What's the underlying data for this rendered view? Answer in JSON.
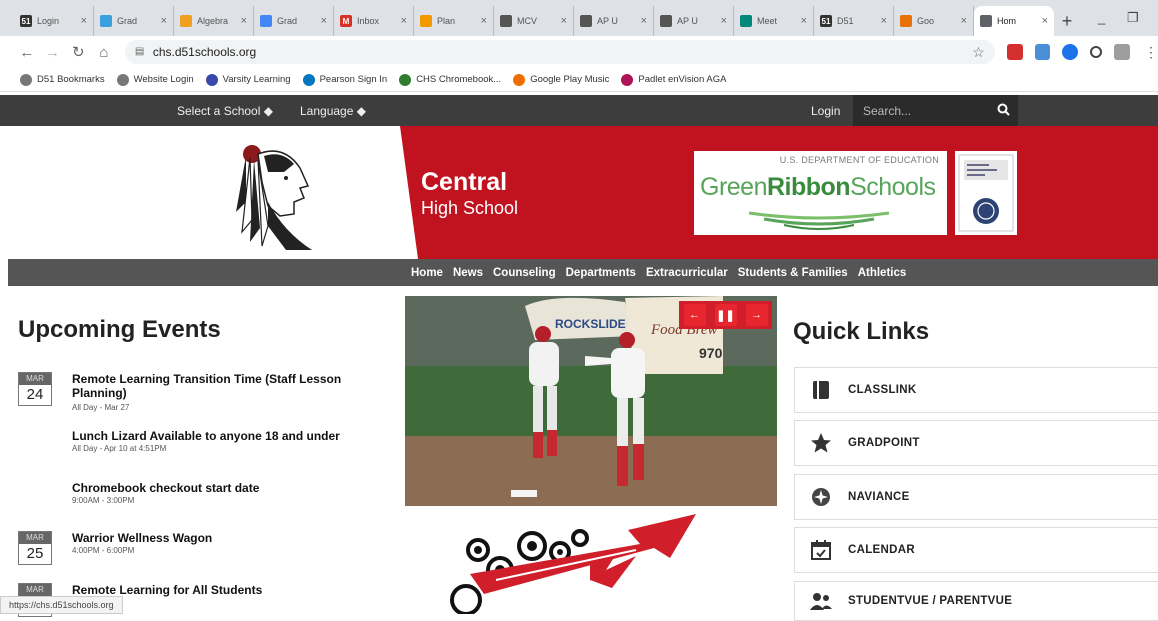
{
  "browser": {
    "tabs": [
      {
        "label": "Login",
        "favicon": "51",
        "color": "#333"
      },
      {
        "label": "Grad",
        "favicon": "",
        "color": "#3aa0e0"
      },
      {
        "label": "Algebra",
        "favicon": "",
        "color": "#f0a020"
      },
      {
        "label": "Grad",
        "favicon": "",
        "color": "#4285f4"
      },
      {
        "label": "Inbox",
        "favicon": "M",
        "color": "#d93025"
      },
      {
        "label": "Plan",
        "favicon": "",
        "color": "#f29900"
      },
      {
        "label": "MCV",
        "favicon": "",
        "color": "#555"
      },
      {
        "label": "AP U",
        "favicon": "",
        "color": "#555"
      },
      {
        "label": "AP U",
        "favicon": "",
        "color": "#555"
      },
      {
        "label": "Meet",
        "favicon": "",
        "color": "#00897b"
      },
      {
        "label": "D51",
        "favicon": "51",
        "color": "#333"
      },
      {
        "label": "Goo",
        "favicon": "",
        "color": "#e8710a"
      },
      {
        "label": "Hom",
        "favicon": "",
        "color": "#5f6368",
        "active": true
      }
    ],
    "new_tab": "+",
    "minimize": "_",
    "restore": "❐",
    "url": "chs.d51schools.org",
    "status_url": "https://chs.d51schools.org"
  },
  "bookmarks": [
    {
      "label": "D51 Bookmarks",
      "color": "#777"
    },
    {
      "label": "Website Login",
      "color": "#777"
    },
    {
      "label": "Varsity Learning",
      "color": "#3949ab"
    },
    {
      "label": "Pearson Sign In",
      "color": "#0277bd"
    },
    {
      "label": "CHS Chromebook...",
      "color": "#2e7d32"
    },
    {
      "label": "Google Play Music",
      "color": "#ef6c00"
    },
    {
      "label": "Padlet enVision AGA",
      "color": "#ad1457"
    }
  ],
  "header": {
    "select_school": "Select a School ◆",
    "language": "Language ◆",
    "login": "Login",
    "search_placeholder": "Search..."
  },
  "banner": {
    "school_name": "Central",
    "school_sub": "High School",
    "award_dept": "U.S. DEPARTMENT OF EDUCATION",
    "award_name_light": "Green",
    "award_name_bold": "Ribbon",
    "award_name_end": "Schools"
  },
  "nav": [
    "Home",
    "News",
    "Counseling",
    "Departments",
    "Extracurricular",
    "Students & Families",
    "Athletics"
  ],
  "events": {
    "title": "Upcoming Events",
    "items": [
      {
        "month": "MAR",
        "day": "24",
        "title": "Remote Learning Transition Time (Staff Lesson Planning)",
        "time": "All Day - Mar 27"
      },
      {
        "month": "",
        "day": "",
        "title": "Lunch Lizard Available to anyone 18 and under",
        "time": "All Day - Apr 10 at 4:51PM"
      },
      {
        "month": "",
        "day": "",
        "title": "Chromebook checkout start date",
        "time": "9:00AM - 3:00PM"
      },
      {
        "month": "MAR",
        "day": "25",
        "title": "Warrior Wellness Wagon",
        "time": "4:00PM - 6:00PM"
      },
      {
        "month": "MAR",
        "day": "",
        "title": "Remote Learning for All Students",
        "time": ""
      }
    ]
  },
  "slideshow": {
    "prev": "←",
    "pause": "❚❚",
    "next": "→",
    "sign_text": "ROCKSLIDE",
    "sign_text2": "Food Brew",
    "sign_num": "970"
  },
  "quick_links": {
    "title": "Quick Links",
    "items": [
      "CLASSLINK",
      "GRADPOINT",
      "NAVIANCE",
      "CALENDAR",
      "STUDENTVUE / PARENTVUE"
    ]
  },
  "colors": {
    "brand_red": "#c1121f",
    "header_dark": "#3d3d3d",
    "nav_gray": "#555555",
    "award_green": "#58a45a"
  }
}
